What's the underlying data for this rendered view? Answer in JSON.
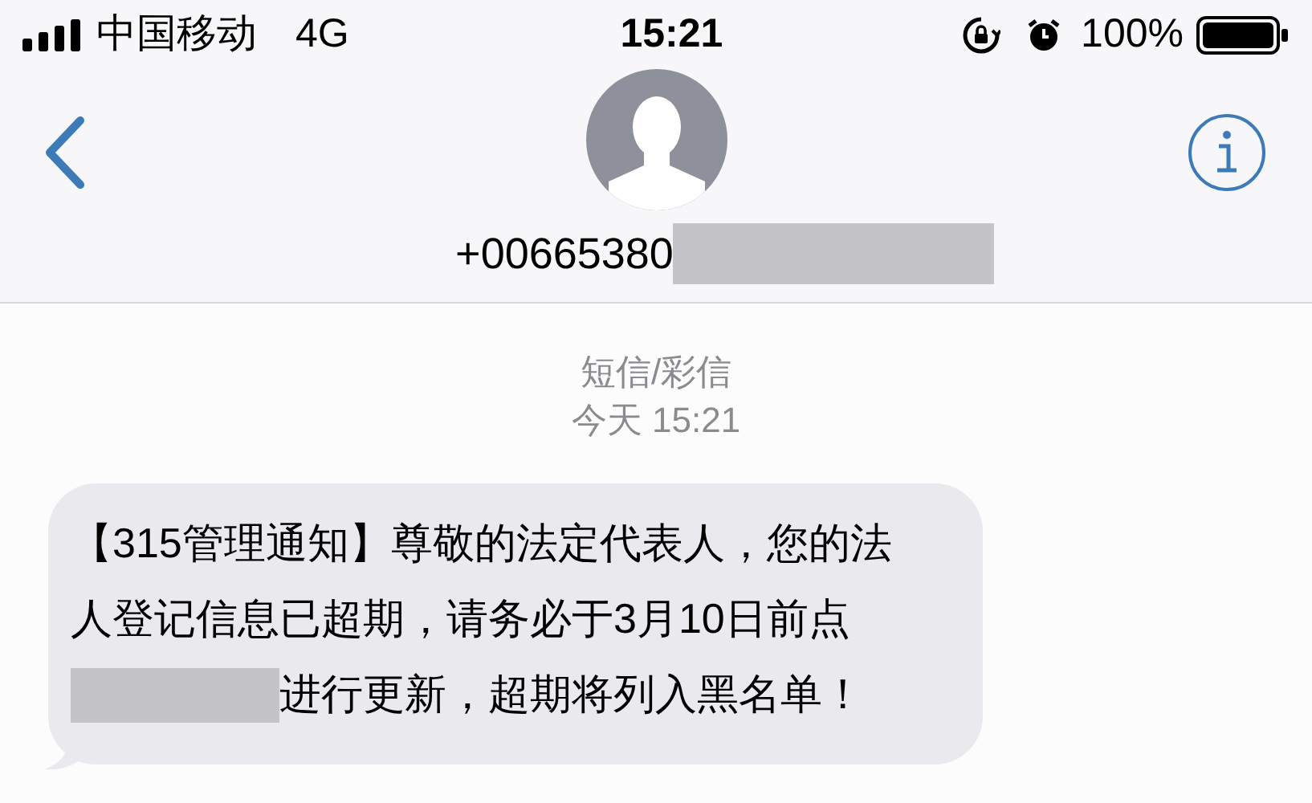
{
  "status_bar": {
    "carrier": "中国移动",
    "network": "4G",
    "time": "15:21",
    "battery": "100%"
  },
  "contact": {
    "phone": "+00665380"
  },
  "thread": {
    "service": "短信/彩信",
    "timestamp": "今天 15:21"
  },
  "message": {
    "lines": [
      {
        "text": "【315管理通知】尊敬的法定代表人，您的法",
        "redacted_before": false
      },
      {
        "text": "人登记信息已超期，请务必于3月10日前点",
        "redacted_before": false
      },
      {
        "text": "进行更新，超期将列入黑名单！",
        "redacted_before": true
      }
    ]
  }
}
